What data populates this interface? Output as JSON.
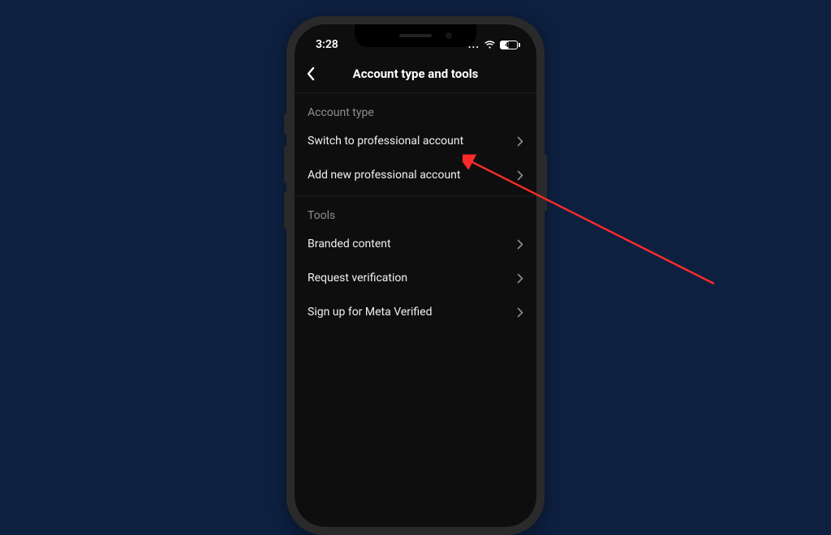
{
  "status": {
    "time": "3:28",
    "dots": "...",
    "battery_pct": "47"
  },
  "header": {
    "title": "Account type and tools"
  },
  "sections": {
    "account_type": {
      "header": "Account type",
      "items": [
        {
          "label": "Switch to professional account"
        },
        {
          "label": "Add new professional account"
        }
      ]
    },
    "tools": {
      "header": "Tools",
      "items": [
        {
          "label": "Branded content"
        },
        {
          "label": "Request verification"
        },
        {
          "label": "Sign up for Meta Verified"
        }
      ]
    }
  },
  "annotation": {
    "arrow_color": "#ff2a2a"
  }
}
